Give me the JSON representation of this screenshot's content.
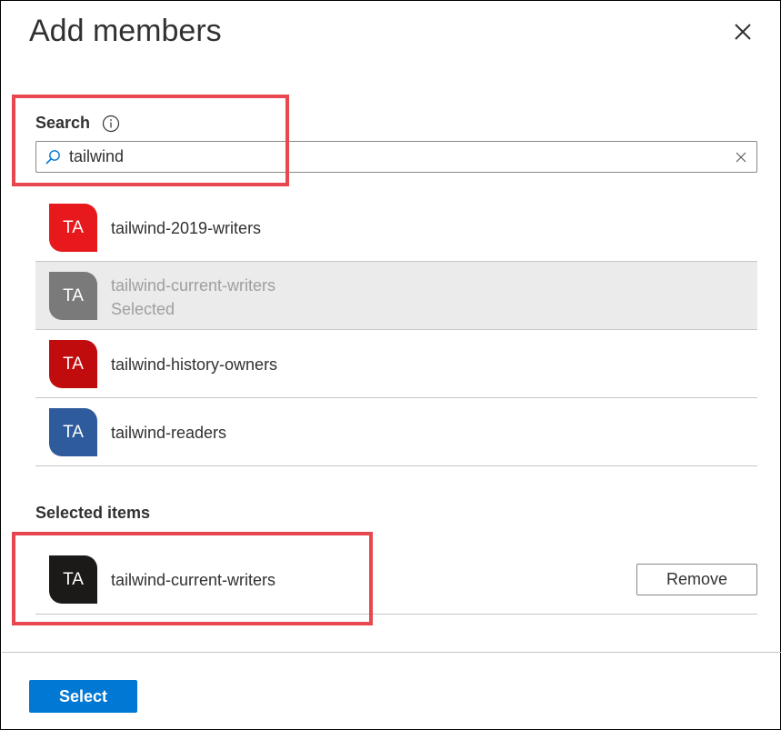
{
  "dialog": {
    "title": "Add members",
    "close_icon": "close-icon"
  },
  "search": {
    "label": "Search",
    "info_icon": "info-icon",
    "search_icon": "search-icon",
    "value": "tailwind",
    "clear_icon": "clear-icon"
  },
  "results": [
    {
      "initials": "TA",
      "name": "tailwind-2019-writers",
      "sub": "",
      "avatar_color": "#e8191c",
      "selected": false
    },
    {
      "initials": "TA",
      "name": "tailwind-current-writers",
      "sub": "Selected",
      "avatar_color": "#7a7a7a",
      "selected": true
    },
    {
      "initials": "TA",
      "name": "tailwind-history-owners",
      "sub": "",
      "avatar_color": "#c10c0e",
      "selected": false
    },
    {
      "initials": "TA",
      "name": "tailwind-readers",
      "sub": "",
      "avatar_color": "#2d5b9c",
      "selected": false
    }
  ],
  "selected_items": {
    "title": "Selected items",
    "items": [
      {
        "initials": "TA",
        "name": "tailwind-current-writers",
        "avatar_color": "#1b1a19",
        "remove_label": "Remove"
      }
    ]
  },
  "footer": {
    "select_label": "Select"
  },
  "colors": {
    "primary": "#0078d4",
    "highlight": "#e8474f"
  }
}
